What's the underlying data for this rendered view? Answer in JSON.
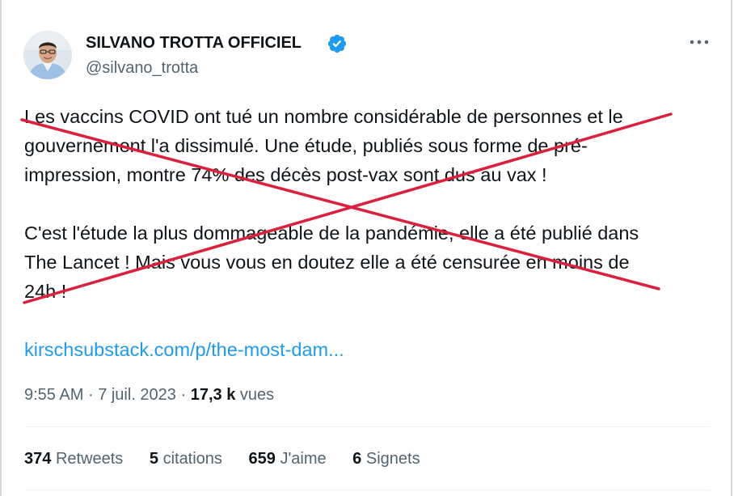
{
  "author": {
    "display_name": "SILVANO TROTTA OFFICIEL",
    "handle": "@silvano_trotta"
  },
  "tweet": {
    "paragraphs": [
      [
        "Les vaccins COVID ont tué un nombre considérable de personnes et le",
        "gouvernement l'a dissimulé. Une étude, publiés sous forme de pré-",
        "impression, montre 74% des décès post-vax sont dus au vax !"
      ],
      [
        "C'est l'étude la plus dommageable de la pandémie, elle a été publié dans",
        "The Lancet ! Mais vous vous en doutez elle a été censurée en moins de",
        "24h !"
      ]
    ],
    "link": "kirschsubstack.com/p/the-most-dam...",
    "time": "9:55 AM",
    "separator": "·",
    "date": "7 juil. 2023",
    "views_count": "17,3 k",
    "views_label": "vues"
  },
  "stats": [
    {
      "count": "374",
      "label": "Retweets"
    },
    {
      "count": "5",
      "label": "citations"
    },
    {
      "count": "659",
      "label": "J'aime"
    },
    {
      "count": "6",
      "label": "Signets"
    }
  ],
  "icons": {
    "verified": "verified-badge-icon",
    "more": "more-options-icon"
  },
  "colors": {
    "verified_blue": "#1d9bf0",
    "link_blue": "#1d9bf0",
    "cross_red": "#dc1f3a",
    "secondary_text": "#536471"
  }
}
